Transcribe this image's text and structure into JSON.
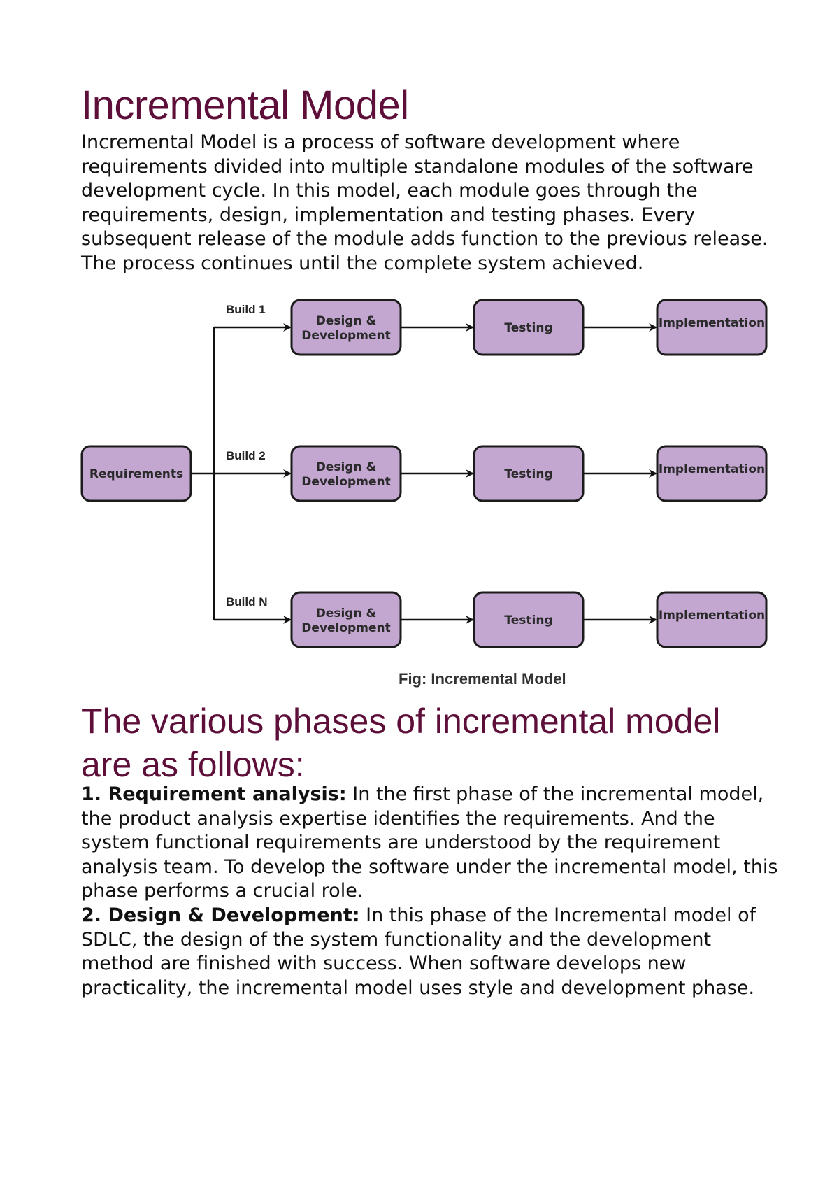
{
  "title": "Incremental Model",
  "intro": "Incremental Model is a process of software development where requirements divided into multiple standalone modules of the software development cycle. In this model, each module goes through the requirements, design, implementation and testing phases. Every subsequent release of the module adds function to the previous release. The process continues until the complete system achieved.",
  "diagram": {
    "source": {
      "label": "Requirements"
    },
    "builds": [
      {
        "label": "Build 1",
        "steps": [
          {
            "line1": "Design &",
            "line2": "Development"
          },
          {
            "line1": "Testing"
          },
          {
            "line1": "Implementation"
          }
        ]
      },
      {
        "label": "Build 2",
        "steps": [
          {
            "line1": "Design &",
            "line2": "Development"
          },
          {
            "line1": "Testing"
          },
          {
            "line1": "Implementation"
          }
        ]
      },
      {
        "label": "Build N",
        "steps": [
          {
            "line1": "Design &",
            "line2": "Development"
          },
          {
            "line1": "Testing"
          },
          {
            "line1": "Implementation"
          }
        ]
      }
    ],
    "caption": "Fig: Incremental Model",
    "colors": {
      "box_fill": "#c3a7d1",
      "box_stroke": "#1b1b1b"
    }
  },
  "phases_heading": "The various phases of incremental model are as follows:",
  "phases": [
    {
      "label": "1. Requirement analysis:",
      "text": " In the first phase of the incremental model, the product analysis expertise identifies the requirements. And the system functional requirements are understood by the requirement analysis team. To develop the software under the incremental model, this phase performs a crucial role."
    },
    {
      "label": "2. Design & Development:",
      "text": " In this phase of the Incremental model of SDLC, the design of the system functionality and the development method are finished with success. When software develops new practicality, the incremental model uses style and development phase."
    }
  ],
  "colors": {
    "heading": "#5e0f39",
    "text": "#111111"
  }
}
